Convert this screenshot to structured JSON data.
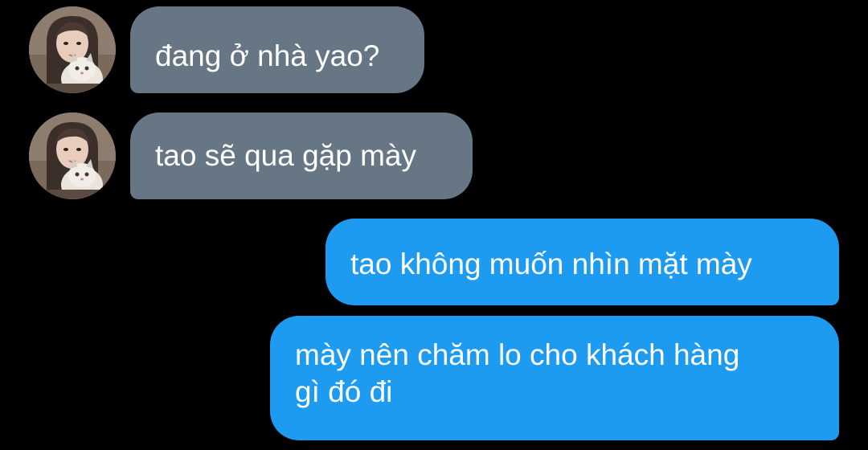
{
  "conversation": {
    "messages": [
      {
        "direction": "incoming",
        "text": "đang ở nhà yao?"
      },
      {
        "direction": "incoming",
        "text": "tao sẽ qua gặp mày"
      },
      {
        "direction": "outgoing",
        "text": "tao không muốn nhìn mặt mày"
      },
      {
        "direction": "outgoing",
        "lines": [
          "mày nên chăm lo cho khách hàng",
          "gì đó đi"
        ]
      }
    ]
  },
  "colors": {
    "background": "#000000",
    "incoming_bubble": "#667685",
    "outgoing_bubble": "#1d9bf0",
    "text": "#ffffff"
  },
  "icons": {
    "avatar": "user-avatar-photo"
  }
}
